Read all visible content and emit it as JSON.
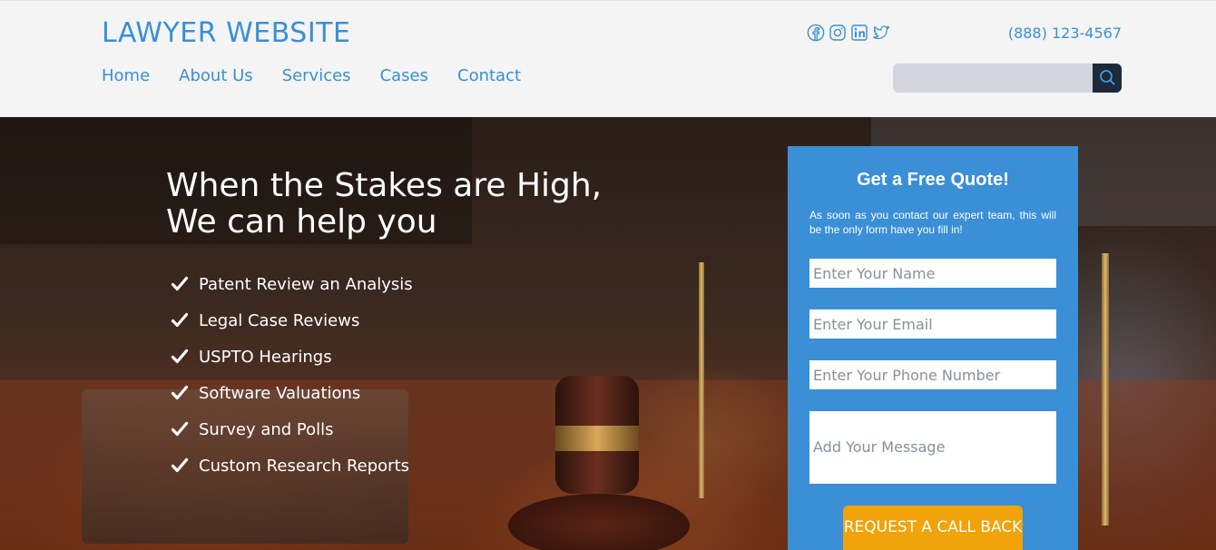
{
  "header": {
    "brand": "LAWYER WEBSITE",
    "nav": [
      "Home",
      "About Us",
      "Services",
      "Cases",
      "Contact"
    ],
    "social_icons": [
      "facebook-icon",
      "instagram-icon",
      "linkedin-icon",
      "twitter-icon"
    ],
    "phone": "(888) 123-4567",
    "search": {
      "placeholder": "",
      "icon": "search-icon"
    }
  },
  "hero": {
    "title_line1": "When the Stakes are High,",
    "title_line2": "We can help you",
    "features": [
      "Patent Review an Analysis",
      "Legal Case Reviews",
      "USPTO Hearings",
      "Software Valuations",
      "Survey and Polls",
      "Custom Research Reports"
    ],
    "feature_icon": "checkmark-icon"
  },
  "quote_form": {
    "title": "Get a Free Quote!",
    "description": "As soon as you contact our expert team, this will be the only form have you fill in!",
    "name_placeholder": "Enter Your Name",
    "email_placeholder": "Enter Your Email",
    "phone_placeholder": "Enter Your Phone Number",
    "message_placeholder": "Add Your Message",
    "submit_label": "REQUEST A CALL BACK"
  },
  "colors": {
    "accent": "#3a8fd6",
    "button": "#f0a30a",
    "header_bg": "#f4f4f4",
    "search_button": "#1d2a3c"
  }
}
